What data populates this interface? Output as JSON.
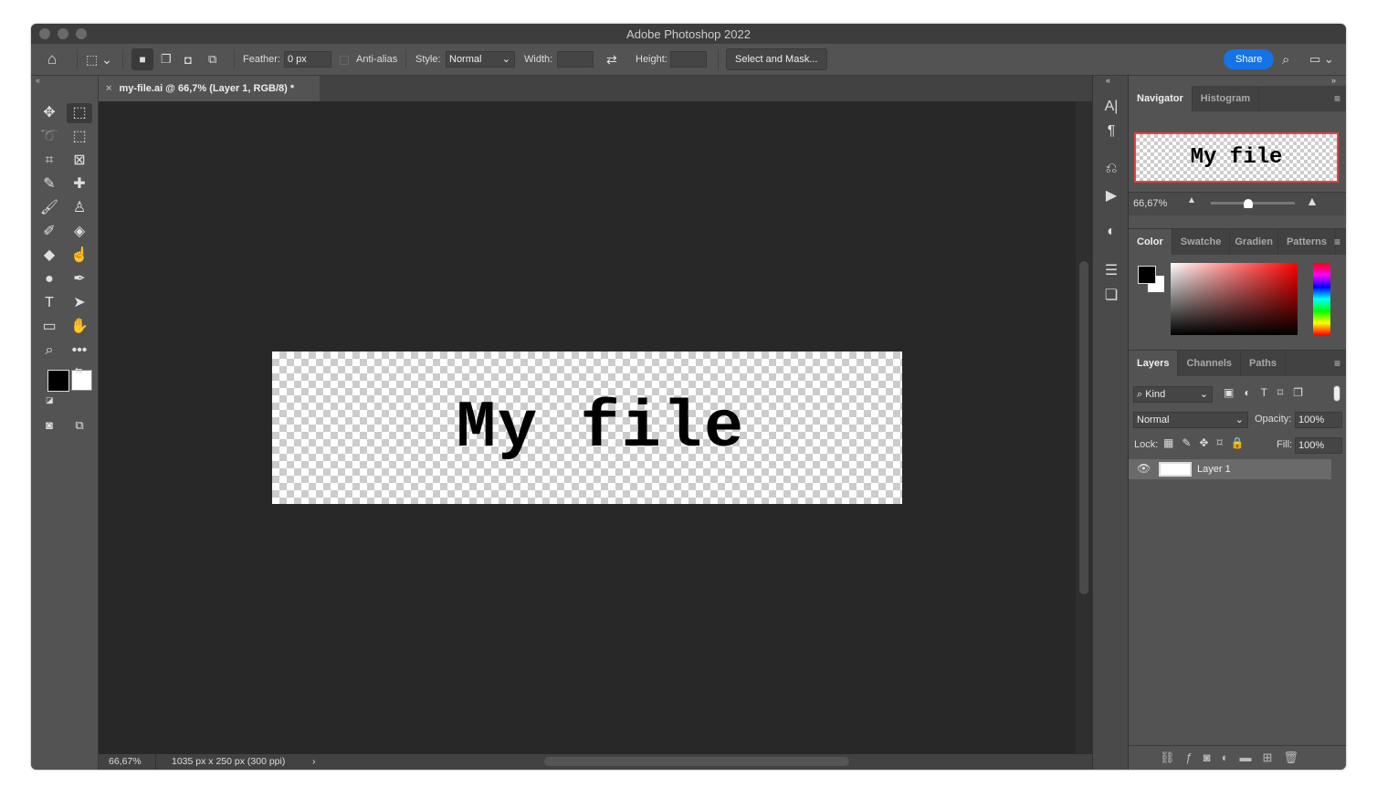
{
  "window": {
    "title": "Adobe Photoshop 2022"
  },
  "options": {
    "feather_label": "Feather:",
    "feather_value": "0 px",
    "antialias_label": "Anti-alias",
    "style_label": "Style:",
    "style_value": "Normal",
    "width_label": "Width:",
    "height_label": "Height:",
    "select_mask_label": "Select and Mask...",
    "share_label": "Share"
  },
  "document": {
    "tab_title": "my-file.ai @ 66,7% (Layer 1, RGB/8) *",
    "close": "×",
    "text": "My file"
  },
  "status": {
    "zoom": "66,67%",
    "dimensions": "1035 px x 250 px (300 ppi)",
    "arrow": "›"
  },
  "navigator": {
    "tabs": [
      "Navigator",
      "Histogram"
    ],
    "zoom": "66,67%",
    "preview_text": "My file",
    "frame_color": "#e8423f",
    "slider_value": 0.5
  },
  "color_panel": {
    "tabs": [
      "Color",
      "Swatche",
      "Gradien",
      "Patterns"
    ],
    "foreground": "#000000",
    "background": "#ffffff"
  },
  "layers": {
    "tabs": [
      "Layers",
      "Channels",
      "Paths"
    ],
    "filter": "Kind",
    "blend_mode": "Normal",
    "opacity_label": "Opacity:",
    "opacity": "100%",
    "lock_label": "Lock:",
    "fill_label": "Fill:",
    "fill": "100%",
    "items": [
      {
        "name": "Layer 1",
        "visible": true
      }
    ]
  },
  "colors": {
    "accent": "#1473e6",
    "canvas_bg": "#282828",
    "panel_bg": "#535353"
  }
}
